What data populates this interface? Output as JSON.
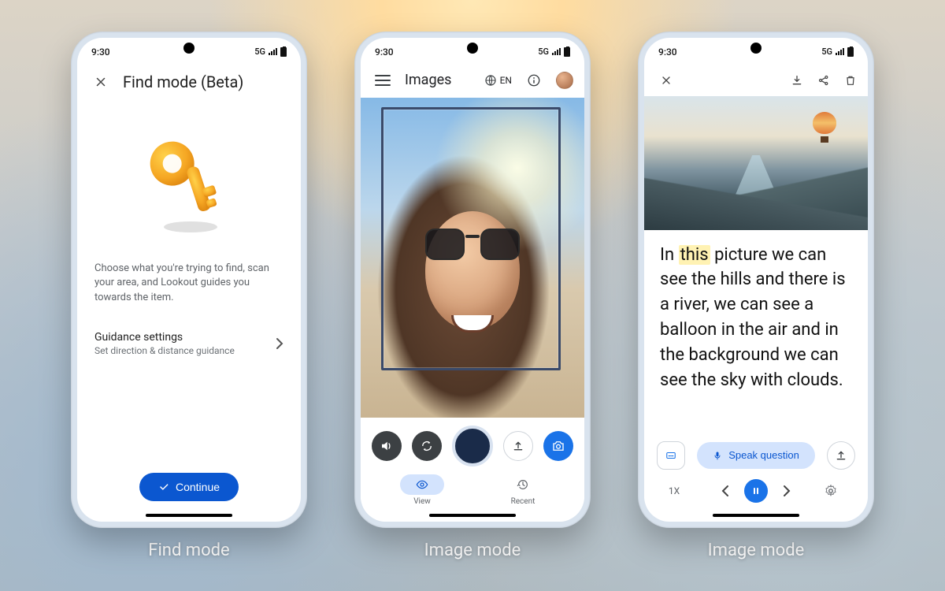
{
  "status": {
    "time": "9:30",
    "net": "5G"
  },
  "captions": {
    "p1": "Find mode",
    "p2": "Image mode",
    "p3": "Image mode"
  },
  "phone1": {
    "title": "Find mode (Beta)",
    "desc": "Choose what you're trying to find, scan your area, and Lookout guides you towards the item.",
    "settings_label": "Guidance settings",
    "settings_sub": "Set direction & distance guidance",
    "continue": "Continue"
  },
  "phone2": {
    "title": "Images",
    "lang": "EN",
    "tabs": {
      "view": "View",
      "recent": "Recent"
    }
  },
  "phone3": {
    "text_pre": "In ",
    "text_hl": "this",
    "text_post": " picture we can see the hills and there is a river, we can see a balloon in the air and in the background we can see the sky with clouds.",
    "speak": "Speak question",
    "zoom": "1X"
  }
}
